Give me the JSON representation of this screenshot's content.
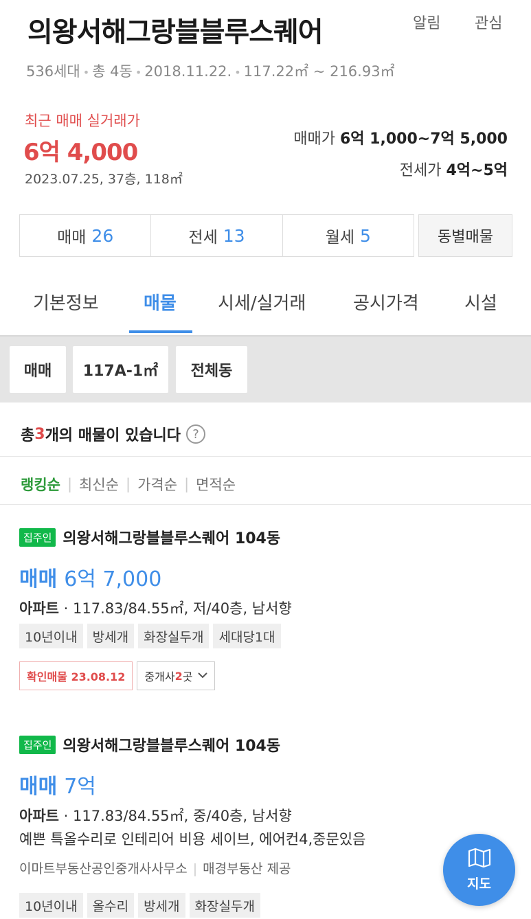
{
  "header": {
    "title": "의왕서해그랑블블루스퀘어",
    "alarm_label": "알림",
    "interest_label": "관심",
    "meta": [
      "536세대",
      "총 4동",
      "2018.11.22.",
      "117.22㎡ ~ 216.93㎡"
    ]
  },
  "recent": {
    "label": "최근 매매 실거래가",
    "price": "6억 4,000",
    "detail": "2023.07.25, 37층, 118㎡"
  },
  "ranges": {
    "sale_label": "매매가",
    "sale_value": "6억 1,000~7억 5,000",
    "jeonse_label": "전세가",
    "jeonse_value": "4억~5억"
  },
  "type_tabs": [
    {
      "label": "매매",
      "count": "26"
    },
    {
      "label": "전세",
      "count": "13"
    },
    {
      "label": "월세",
      "count": "5"
    }
  ],
  "dong_button": "동별매물",
  "main_tabs": [
    "기본정보",
    "매물",
    "시세/실거래",
    "공시가격",
    "시설"
  ],
  "filters": [
    "매매",
    "117A-1㎡",
    "전체동"
  ],
  "count": {
    "prefix": "총 ",
    "num": "3",
    "suffix": "개의 매물이 있습니다",
    "help": "?"
  },
  "sort": [
    "랭킹순",
    "최신순",
    "가격순",
    "면적순"
  ],
  "listings": [
    {
      "badge": "집주인",
      "name": "의왕서해그랑블블루스퀘어 104동",
      "kind": "매매",
      "price": "6억 7,000",
      "type": "아파트",
      "info": " · 117.83/84.55㎡, 저/40층, 남서향",
      "tags": [
        "10년이내",
        "방세개",
        "화장실두개",
        "세대당1대"
      ],
      "verify": "확인매물 23.08.12",
      "agent_prefix": "중개사 ",
      "agent_num": "2",
      "agent_suffix": "곳"
    },
    {
      "badge": "집주인",
      "name": "의왕서해그랑블블루스퀘어 104동",
      "kind": "매매",
      "price": "7억",
      "type": "아파트",
      "info": " · 117.83/84.55㎡, 중/40층, 남서향",
      "desc": "예쁜 특올수리로 인테리어 비용 세이브, 에어컨4,중문있음",
      "agent": "이마트부동산공인중개사사무소",
      "provider": "매경부동산 제공",
      "tags": [
        "10년이내",
        "올수리",
        "방세개",
        "화장실두개"
      ]
    }
  ],
  "map_fab": {
    "label": "지도",
    "icon": "map-icon"
  },
  "colors": {
    "accent": "#3f8ee8",
    "red": "#e04c4c",
    "green": "#11b84a"
  }
}
